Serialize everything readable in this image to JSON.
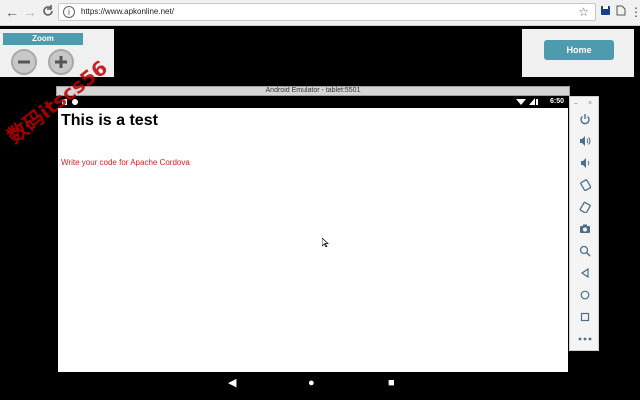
{
  "browser": {
    "url": "https://www.apkonline.net/",
    "back": "←",
    "forward": "→",
    "reload": "C",
    "info": "i",
    "star": "☆",
    "menu": "⋮"
  },
  "zoom": {
    "label": "Zoom"
  },
  "home": {
    "label": "Home"
  },
  "emulator": {
    "title": "Android Emulator - tablet:5501",
    "status": {
      "clock": "6:50"
    },
    "screen": {
      "heading": "This is a test",
      "message": "Write your code for Apache Cordova"
    },
    "navbar": {
      "back": "◀",
      "home": "●",
      "recent": "■"
    }
  },
  "sidebar": {
    "minimize": "–",
    "close": "×",
    "icons": [
      "power-icon",
      "volume-up-icon",
      "volume-down-icon",
      "rotate-left-icon",
      "rotate-right-icon",
      "camera-icon",
      "zoom-icon",
      "back-icon",
      "home-icon",
      "overview-icon",
      "more-icon"
    ]
  },
  "watermark": "数码itscs56"
}
